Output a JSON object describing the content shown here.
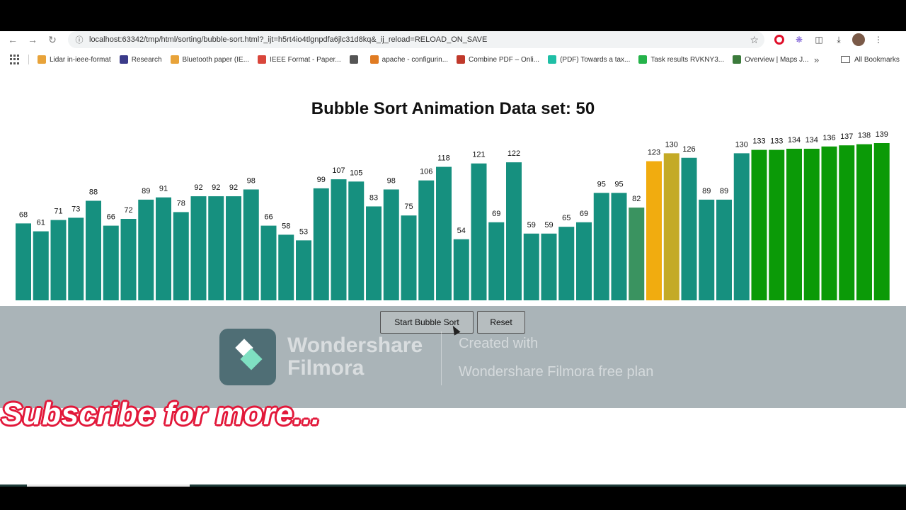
{
  "browser": {
    "url": "localhost:63342/tmp/html/sorting/bubble-sort.html?_ijt=h5rt4io4tlgnpdfa6jlc31d8kq&_ij_reload=RELOAD_ON_SAVE",
    "bookmarks": [
      {
        "label": "Lidar in-ieee-format",
        "icon": "doc-icon",
        "color": "#e8a33a"
      },
      {
        "label": "Research",
        "icon": "n-logo-icon",
        "color": "#3b3b8a"
      },
      {
        "label": "Bluetooth paper (IE...",
        "icon": "doc-icon",
        "color": "#e8a33a"
      },
      {
        "label": "IEEE Format - Paper...",
        "icon": "slides-icon",
        "color": "#d9463b"
      },
      {
        "label": "",
        "icon": "globe-icon",
        "color": "#555555"
      },
      {
        "label": "apache - configurin...",
        "icon": "stack-icon",
        "color": "#e07b22"
      },
      {
        "label": "Combine PDF – Onli...",
        "icon": "pdf-icon",
        "color": "#c0392b"
      },
      {
        "label": "(PDF) Towards a tax...",
        "icon": "rg-icon",
        "color": "#1fbfa6"
      },
      {
        "label": "Task results RVKNY3...",
        "icon": "s-icon",
        "color": "#25b34a"
      },
      {
        "label": "Overview | Maps J...",
        "icon": "code-icon",
        "color": "#3b7a3b"
      }
    ],
    "more_label": "»",
    "all_bookmarks_label": "All Bookmarks"
  },
  "page": {
    "title": "Bubble Sort Animation Data set: 50",
    "start_label": "Start Bubble Sort",
    "reset_label": "Reset"
  },
  "watermark": {
    "brand": "Wondershare Filmora",
    "brand_line1": "Wondershare",
    "brand_line2": "Filmora",
    "created": "Created with",
    "plan": "Wondershare Filmora free plan"
  },
  "overlay": {
    "subscribe": "Subscribe for more..."
  },
  "video_progress": 0.18,
  "chart_data": {
    "type": "bar",
    "title": "",
    "values": [
      68,
      61,
      71,
      73,
      88,
      66,
      72,
      89,
      91,
      78,
      92,
      92,
      92,
      98,
      66,
      58,
      53,
      99,
      107,
      105,
      83,
      98,
      75,
      106,
      118,
      54,
      121,
      69,
      122,
      59,
      59,
      65,
      69,
      95,
      95,
      82,
      123,
      130,
      126,
      89,
      89,
      130,
      133,
      133,
      134,
      134,
      136,
      137,
      138,
      139
    ],
    "states": [
      "unsorted",
      "unsorted",
      "unsorted",
      "unsorted",
      "unsorted",
      "unsorted",
      "unsorted",
      "unsorted",
      "unsorted",
      "unsorted",
      "unsorted",
      "unsorted",
      "unsorted",
      "unsorted",
      "unsorted",
      "unsorted",
      "unsorted",
      "unsorted",
      "unsorted",
      "unsorted",
      "unsorted",
      "unsorted",
      "unsorted",
      "unsorted",
      "unsorted",
      "unsorted",
      "unsorted",
      "unsorted",
      "unsorted",
      "unsorted",
      "unsorted",
      "unsorted",
      "unsorted",
      "unsorted",
      "unsorted",
      "fading",
      "comparing",
      "comparing-dim",
      "unsorted",
      "unsorted",
      "unsorted",
      "unsorted",
      "sorted",
      "sorted",
      "sorted",
      "sorted",
      "sorted",
      "sorted",
      "sorted",
      "sorted"
    ],
    "colors": {
      "unsorted": "#16907f",
      "fading": "#3a9360",
      "comparing": "#f1ac0f",
      "comparing-dim": "#c4aa26",
      "sorted": "#0b9a07"
    },
    "ylim": [
      0,
      139
    ]
  }
}
